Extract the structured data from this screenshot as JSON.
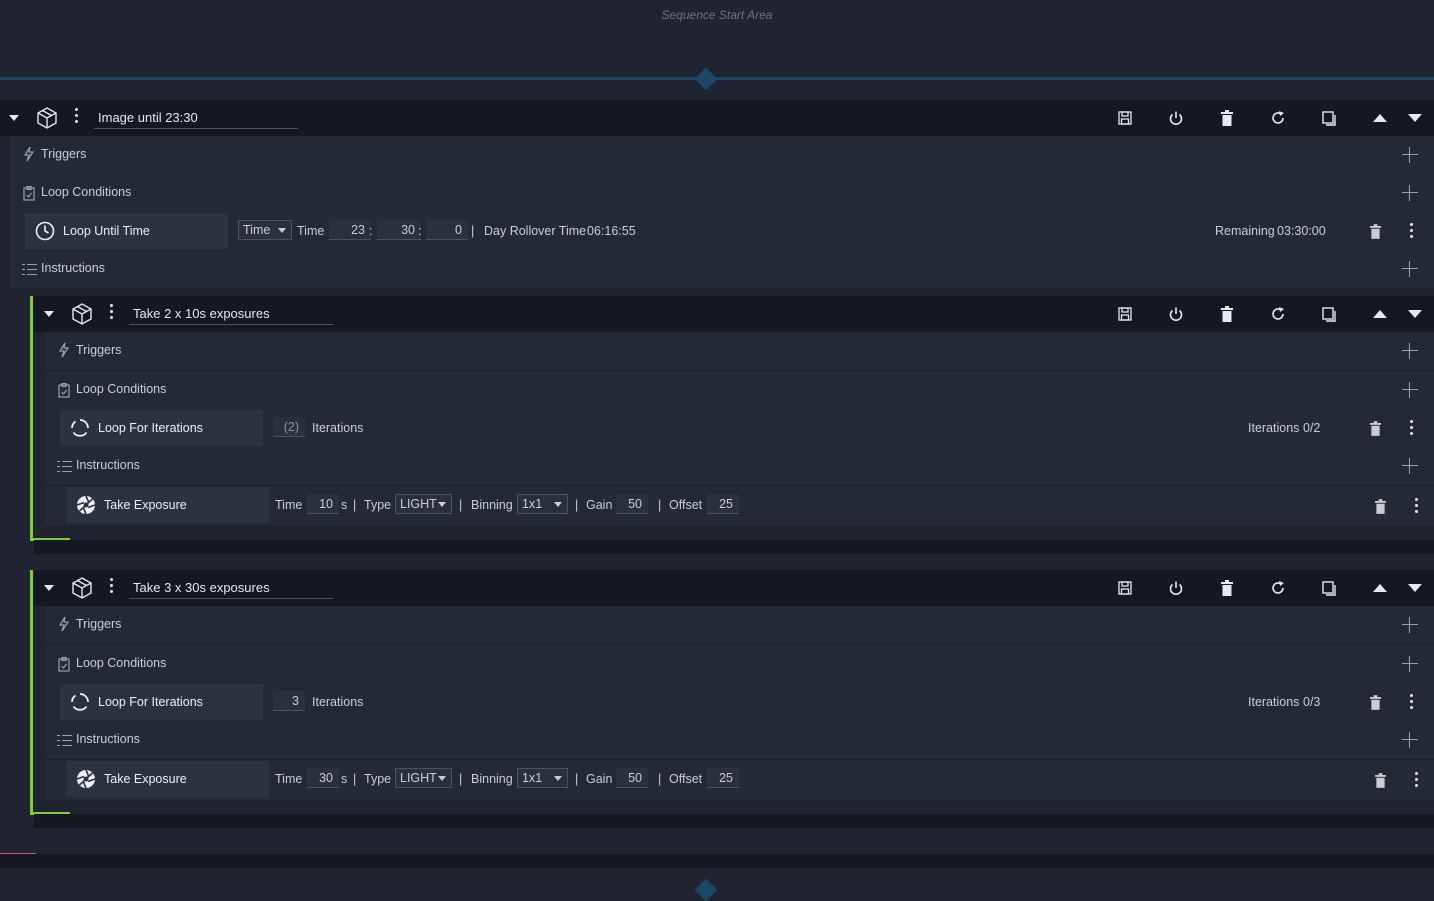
{
  "sequence_start": {
    "label": "Sequence Start Area"
  },
  "outer": {
    "name": "Image until 23:30",
    "triggers_label": "Triggers",
    "loop_conditions_label": "Loop Conditions",
    "instructions_label": "Instructions",
    "loop_item": {
      "name": "Loop Until Time",
      "mode_select": "Time",
      "time_label": "Time",
      "hours": "23",
      "minutes": "30",
      "seconds": "0",
      "sep1": ":",
      "sep2": ":",
      "sep3": "|",
      "rollover_label": "Day Rollover Time",
      "rollover_value": "06:16:55",
      "remaining_label": "Remaining",
      "remaining_value": "03:30:00"
    }
  },
  "blocks": [
    {
      "name": "Take 2 x 10s exposures",
      "triggers_label": "Triggers",
      "loop_conditions_label": "Loop Conditions",
      "instructions_label": "Instructions",
      "loop_item": {
        "name": "Loop For Iterations",
        "iterations": "(2)",
        "iterations_label": "Iterations",
        "progress_label": "Iterations",
        "progress_value": "0/2"
      },
      "exposure": {
        "name": "Take Exposure",
        "time_label": "Time",
        "time": "10",
        "unit": "s",
        "type_label": "Type",
        "type": "LIGHT",
        "binning_label": "Binning",
        "binning": "1x1",
        "gain_label": "Gain",
        "gain": "50",
        "offset_label": "Offset",
        "offset": "25",
        "sep": "|"
      }
    },
    {
      "name": "Take 3 x 30s exposures",
      "triggers_label": "Triggers",
      "loop_conditions_label": "Loop Conditions",
      "instructions_label": "Instructions",
      "loop_item": {
        "name": "Loop For Iterations",
        "iterations": "3",
        "iterations_label": "Iterations",
        "progress_label": "Iterations",
        "progress_value": "0/3"
      },
      "exposure": {
        "name": "Take Exposure",
        "time_label": "Time",
        "time": "30",
        "unit": "s",
        "type_label": "Type",
        "type": "LIGHT",
        "binning_label": "Binning",
        "binning": "1x1",
        "gain_label": "Gain",
        "gain": "50",
        "offset_label": "Offset",
        "offset": "25",
        "sep": "|"
      }
    }
  ],
  "colors": {
    "accent_green": "#7ed321",
    "drop_line": "#1c4a66",
    "background": "#1f2430"
  }
}
